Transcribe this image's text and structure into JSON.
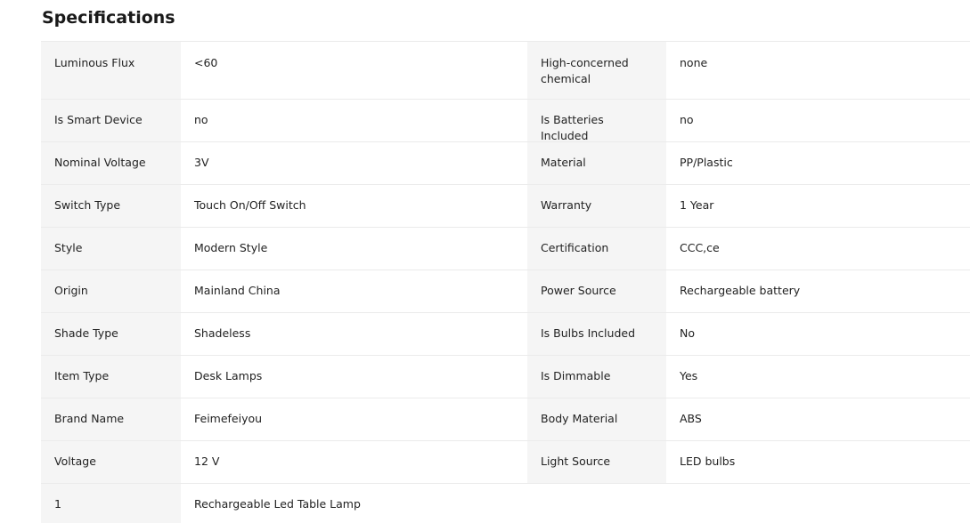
{
  "heading": "Specifications",
  "rows": [
    {
      "k1": "Luminous Flux",
      "v1": "<60",
      "k2": "High-concerned chemical",
      "v2": "none"
    },
    {
      "k1": "Is Smart Device",
      "v1": "no",
      "k2": "Is Batteries Included",
      "v2": "no"
    },
    {
      "k1": "Nominal Voltage",
      "v1": "3V",
      "k2": "Material",
      "v2": "PP/Plastic"
    },
    {
      "k1": "Switch Type",
      "v1": "Touch On/Off Switch",
      "k2": "Warranty",
      "v2": "1 Year"
    },
    {
      "k1": "Style",
      "v1": "Modern Style",
      "k2": "Certification",
      "v2": "CCC,ce"
    },
    {
      "k1": "Origin",
      "v1": "Mainland China",
      "k2": "Power Source",
      "v2": "Rechargeable battery"
    },
    {
      "k1": "Shade Type",
      "v1": "Shadeless",
      "k2": "Is Bulbs Included",
      "v2": "No"
    },
    {
      "k1": "Item Type",
      "v1": "Desk Lamps",
      "k2": "Is Dimmable",
      "v2": "Yes"
    },
    {
      "k1": "Brand Name",
      "v1": "Feimefeiyou",
      "k2": "Body Material",
      "v2": "ABS"
    },
    {
      "k1": "Voltage",
      "v1": "12 V",
      "k2": "Light Source",
      "v2": "LED bulbs"
    },
    {
      "k1": "1",
      "v1": "Rechargeable Led Table Lamp"
    }
  ]
}
